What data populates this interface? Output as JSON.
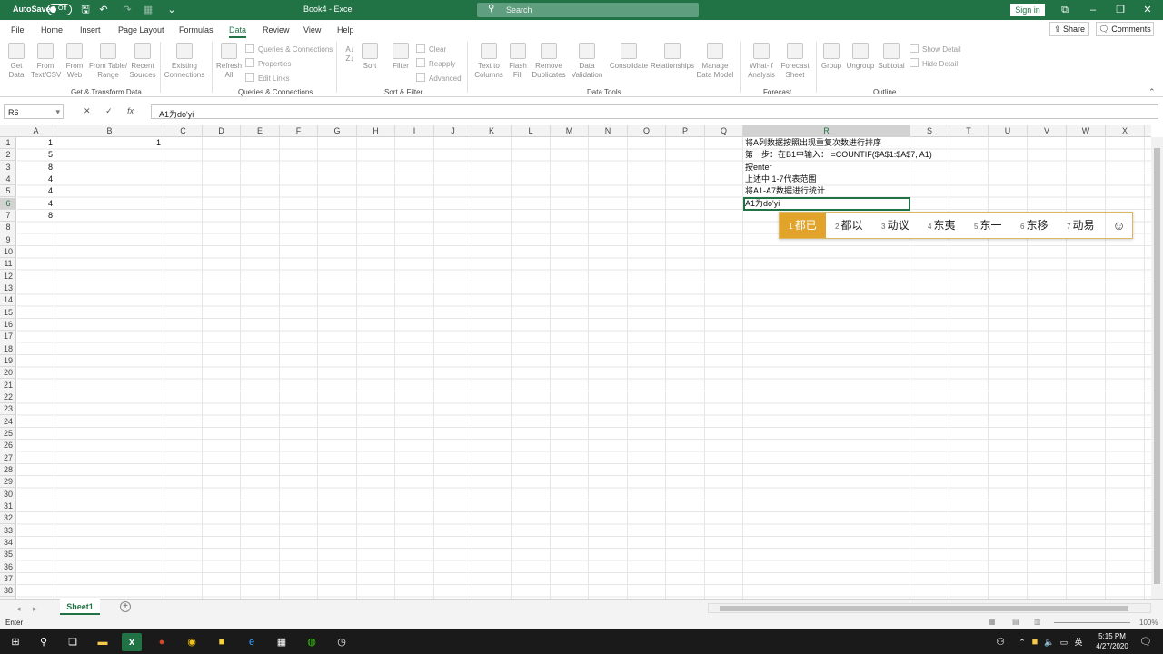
{
  "titlebar": {
    "autosave_label": "AutoSave",
    "autosave_state": "Off",
    "title": "Book4 - Excel",
    "search_placeholder": "Search",
    "signin_label": "Sign in"
  },
  "menu": {
    "items": [
      "File",
      "Home",
      "Insert",
      "Page Layout",
      "Formulas",
      "Data",
      "Review",
      "View",
      "Help"
    ],
    "active": "Data",
    "share_label": "Share",
    "comments_label": "Comments"
  },
  "ribbon": {
    "get_data": {
      "btn1": "Get\nData",
      "btn2": "From\nText/CSV",
      "btn3": "From\nWeb",
      "btn4": "From Table/\nRange",
      "btn5": "Recent\nSources",
      "btn6": "Existing\nConnections",
      "label": "Get & Transform Data"
    },
    "queries": {
      "refresh": "Refresh\nAll",
      "qc": "Queries & Connections",
      "props": "Properties",
      "edit": "Edit Links",
      "label": "Queries & Connections"
    },
    "sort_filter": {
      "sort": "Sort",
      "filter": "Filter",
      "clear": "Clear",
      "reapply": "Reapply",
      "advanced": "Advanced",
      "label": "Sort & Filter"
    },
    "data_tools": {
      "t2c": "Text to\nColumns",
      "flash": "Flash\nFill",
      "dup": "Remove\nDuplicates",
      "dv": "Data\nValidation",
      "cons": "Consolidate",
      "rel": "Relationships",
      "mdm": "Manage\nData Model",
      "label": "Data Tools"
    },
    "forecast": {
      "whatif": "What-If\nAnalysis",
      "sheet": "Forecast\nSheet",
      "label": "Forecast"
    },
    "outline": {
      "group": "Group",
      "ungroup": "Ungroup",
      "subtotal": "Subtotal",
      "show": "Show Detail",
      "hide": "Hide Detail",
      "label": "Outline"
    }
  },
  "formula_bar": {
    "name_box": "R6",
    "formula": "A1为do'yi"
  },
  "columns": [
    "A",
    "B",
    "C",
    "D",
    "E",
    "F",
    "G",
    "H",
    "I",
    "J",
    "K",
    "L",
    "M",
    "N",
    "O",
    "P",
    "Q",
    "R",
    "S",
    "T",
    "U",
    "V",
    "W",
    "X"
  ],
  "selected_column": "R",
  "rows": [
    "1",
    "2",
    "3",
    "4",
    "5",
    "6",
    "7",
    "8",
    "9",
    "10",
    "11",
    "12",
    "13",
    "14",
    "15",
    "16",
    "17",
    "18",
    "19",
    "20",
    "21",
    "22",
    "23",
    "24",
    "25",
    "26",
    "27",
    "28",
    "29",
    "30",
    "31",
    "32",
    "33",
    "34",
    "35",
    "36",
    "37",
    "38"
  ],
  "selected_row": "6",
  "cells": {
    "A": [
      "1",
      "5",
      "8",
      "4",
      "4",
      "4",
      "8"
    ],
    "B1": "1",
    "R": [
      "将A列数据按照出现重复次数进行排序",
      "第一步：在B1中输入：  =COUNTIF($A$1:$A$7, A1)",
      "按enter",
      "上述中 1-7代表范围",
      "将A1-A7数据进行统计",
      "A1为do'yi"
    ]
  },
  "ime": {
    "candidates": [
      {
        "n": "1",
        "t": "都已"
      },
      {
        "n": "2",
        "t": "都以"
      },
      {
        "n": "3",
        "t": "动议"
      },
      {
        "n": "4",
        "t": "东夷"
      },
      {
        "n": "5",
        "t": "东一"
      },
      {
        "n": "6",
        "t": "东移"
      },
      {
        "n": "7",
        "t": "动易"
      }
    ],
    "emoji_icon": "☺"
  },
  "sheet": {
    "tab": "Sheet1",
    "add_icon": "+"
  },
  "status": {
    "mode": "Enter",
    "zoom": "100%"
  },
  "taskbar": {
    "time": "5:15 PM",
    "date": "4/27/2020"
  }
}
